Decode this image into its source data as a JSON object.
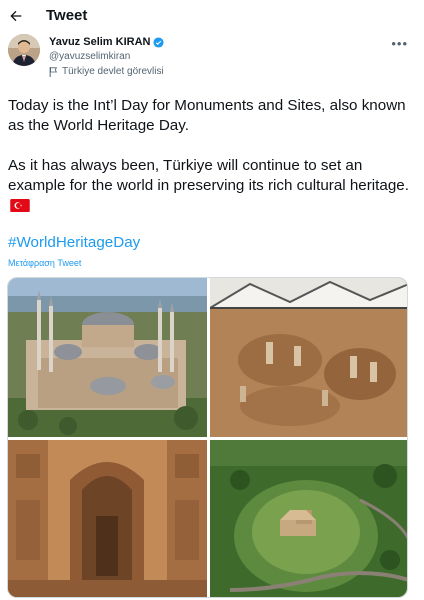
{
  "header": {
    "title": "Tweet",
    "back_icon": "arrow-left-icon"
  },
  "author": {
    "name": "Yavuz Selim KIRAN",
    "handle": "@yavuzselimkiran",
    "label": "Türkiye devlet görevlisi",
    "verified": true
  },
  "tweet": {
    "paragraph1": "Today is the Int’l Day for Monuments and Sites, also known as the World Heritage Day.",
    "paragraph2": "As it has always been, Türkiye will continue to set an example for the world in preserving its rich cultural heritage.",
    "hashtag": "#WorldHeritageDay",
    "translate": "Μετάφραση Tweet"
  },
  "colors": {
    "link": "#1d9bf0",
    "verified": "#1d9bf0",
    "text": "#0f1419",
    "secondary": "#536471"
  }
}
